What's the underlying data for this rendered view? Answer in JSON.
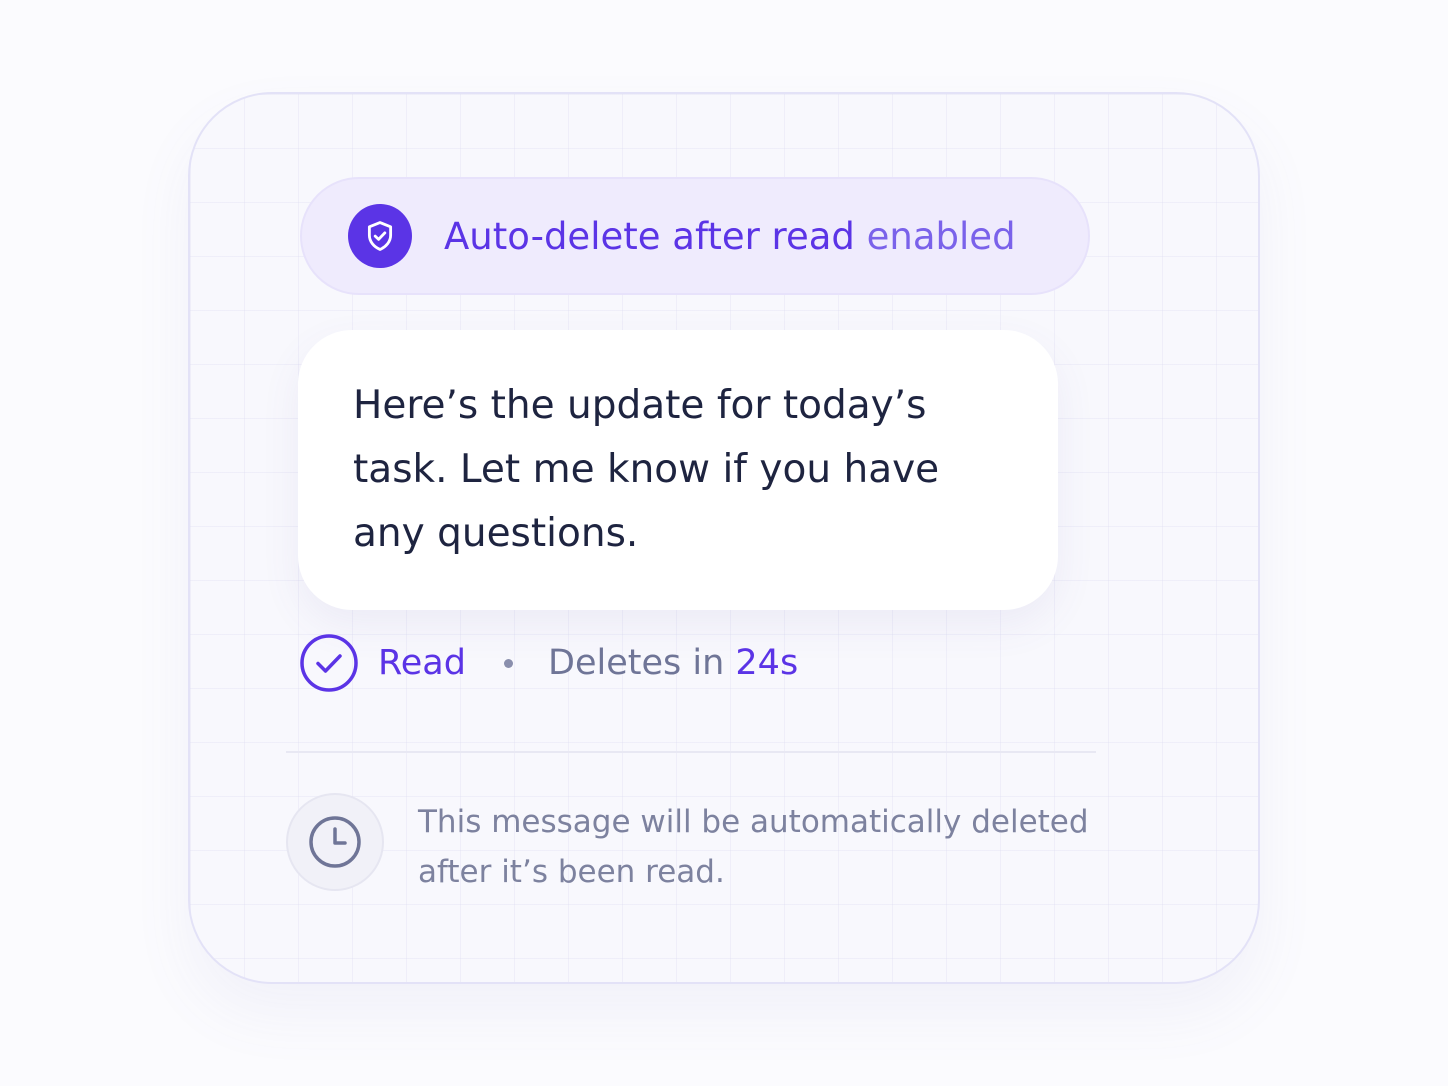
{
  "banner": {
    "title_strong": "Auto-delete after read",
    "title_light": "enabled",
    "icon": "shield-check-icon"
  },
  "message": {
    "text": "Here’s the update for today’s task. Let me know if you have any questions."
  },
  "status": {
    "read_label": "Read",
    "deletes_prefix": "Deletes in",
    "countdown": "24s",
    "icon": "check-circle-icon"
  },
  "note": {
    "text": "This message will be automatically deleted after it’s been read.",
    "icon": "clock-icon"
  },
  "colors": {
    "accent": "#5b34e6",
    "banner_bg": "#efebfd",
    "text_dark": "#1e2440",
    "text_muted": "#7d829f"
  }
}
